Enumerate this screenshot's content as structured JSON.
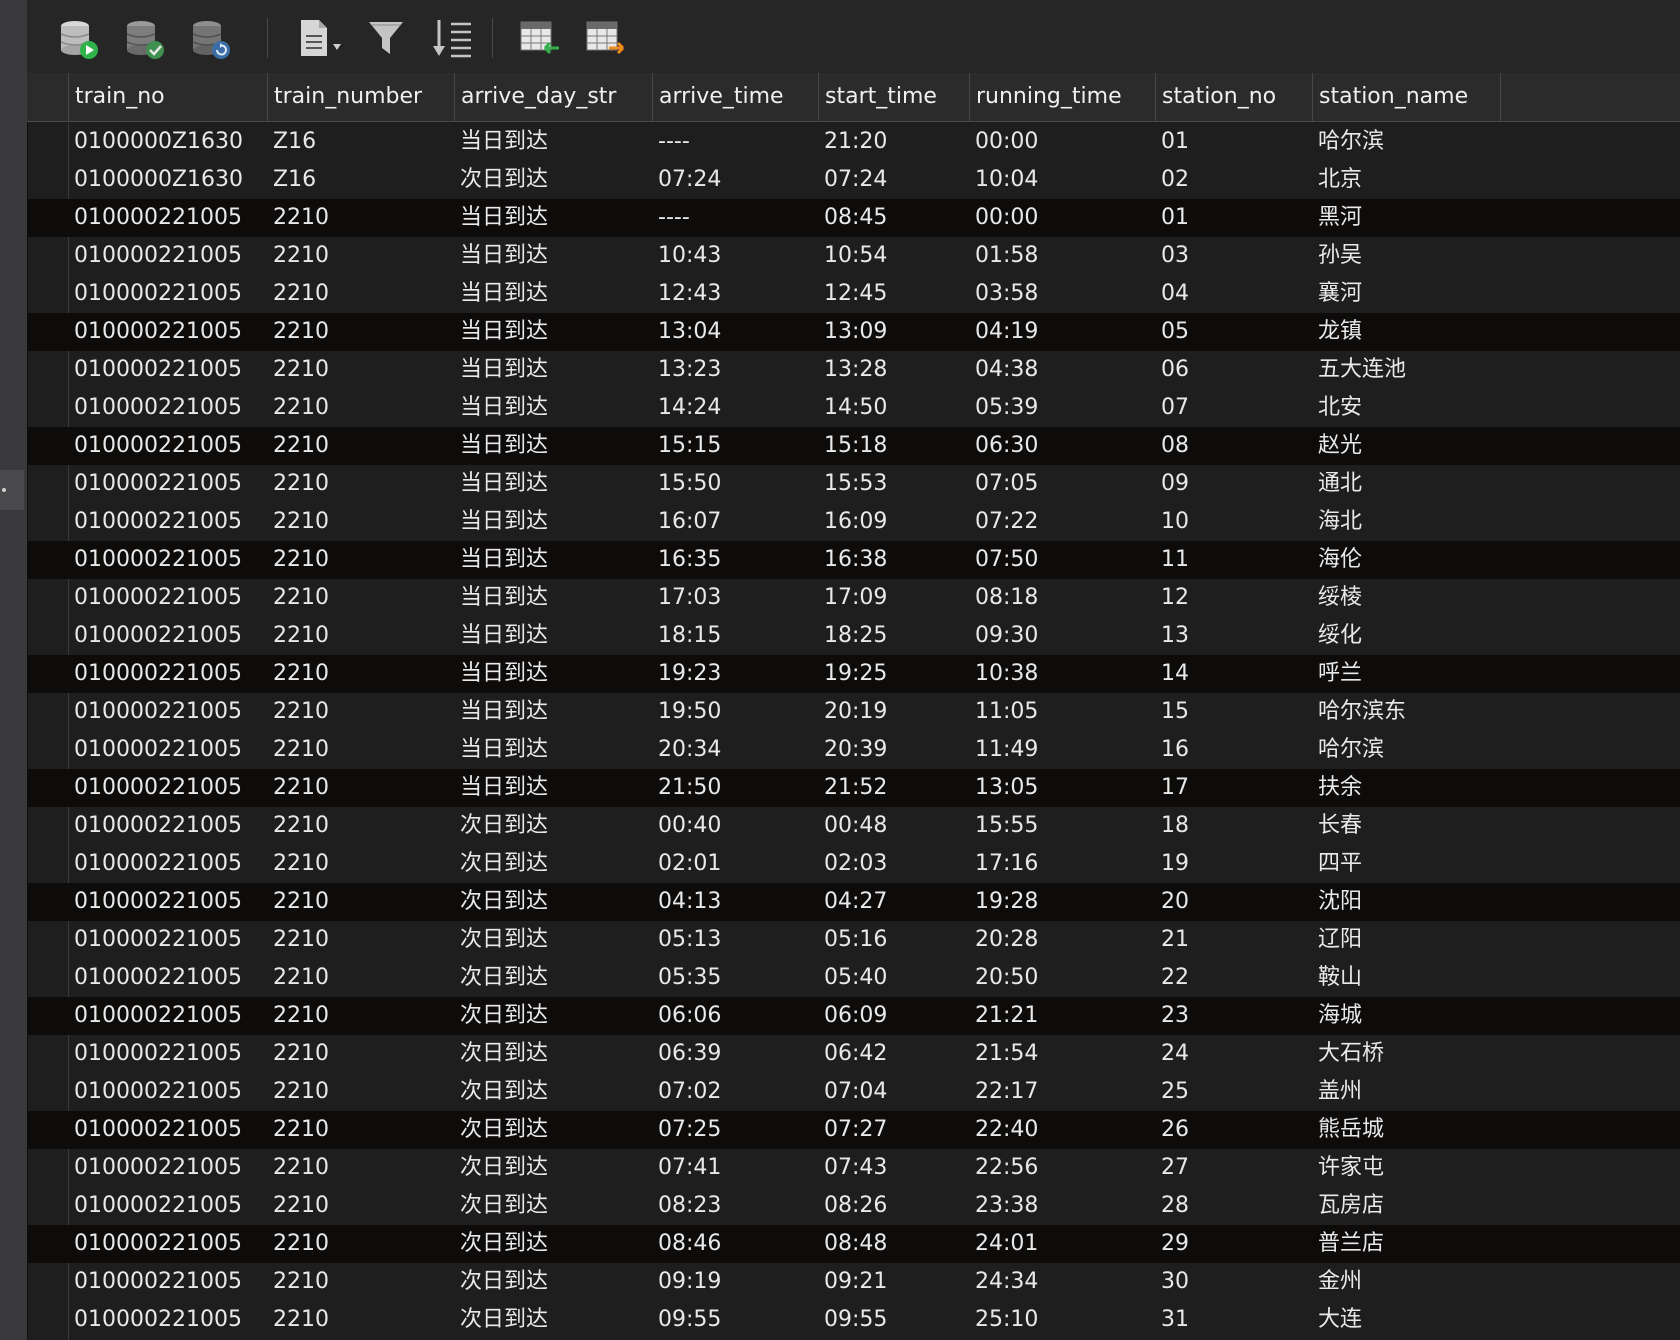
{
  "toolbar": {
    "icons": [
      "database-run-icon",
      "database-check-icon",
      "database-refresh-icon",
      "document-dropdown-icon",
      "filter-icon",
      "sort-icon",
      "table-import-icon",
      "table-export-icon"
    ]
  },
  "columns": [
    "train_no",
    "train_number",
    "arrive_day_str",
    "arrive_time",
    "start_time",
    "running_time",
    "station_no",
    "station_name"
  ],
  "rows": [
    [
      "0100000Z1630",
      "Z16",
      "当日到达",
      "----",
      "21:20",
      "00:00",
      "01",
      "哈尔滨"
    ],
    [
      "0100000Z1630",
      "Z16",
      "次日到达",
      "07:24",
      "07:24",
      "10:04",
      "02",
      "北京"
    ],
    [
      "010000221005",
      "2210",
      "当日到达",
      "----",
      "08:45",
      "00:00",
      "01",
      "黑河"
    ],
    [
      "010000221005",
      "2210",
      "当日到达",
      "10:43",
      "10:54",
      "01:58",
      "03",
      "孙吴"
    ],
    [
      "010000221005",
      "2210",
      "当日到达",
      "12:43",
      "12:45",
      "03:58",
      "04",
      "襄河"
    ],
    [
      "010000221005",
      "2210",
      "当日到达",
      "13:04",
      "13:09",
      "04:19",
      "05",
      "龙镇"
    ],
    [
      "010000221005",
      "2210",
      "当日到达",
      "13:23",
      "13:28",
      "04:38",
      "06",
      "五大连池"
    ],
    [
      "010000221005",
      "2210",
      "当日到达",
      "14:24",
      "14:50",
      "05:39",
      "07",
      "北安"
    ],
    [
      "010000221005",
      "2210",
      "当日到达",
      "15:15",
      "15:18",
      "06:30",
      "08",
      "赵光"
    ],
    [
      "010000221005",
      "2210",
      "当日到达",
      "15:50",
      "15:53",
      "07:05",
      "09",
      "通北"
    ],
    [
      "010000221005",
      "2210",
      "当日到达",
      "16:07",
      "16:09",
      "07:22",
      "10",
      "海北"
    ],
    [
      "010000221005",
      "2210",
      "当日到达",
      "16:35",
      "16:38",
      "07:50",
      "11",
      "海伦"
    ],
    [
      "010000221005",
      "2210",
      "当日到达",
      "17:03",
      "17:09",
      "08:18",
      "12",
      "绥棱"
    ],
    [
      "010000221005",
      "2210",
      "当日到达",
      "18:15",
      "18:25",
      "09:30",
      "13",
      "绥化"
    ],
    [
      "010000221005",
      "2210",
      "当日到达",
      "19:23",
      "19:25",
      "10:38",
      "14",
      "呼兰"
    ],
    [
      "010000221005",
      "2210",
      "当日到达",
      "19:50",
      "20:19",
      "11:05",
      "15",
      "哈尔滨东"
    ],
    [
      "010000221005",
      "2210",
      "当日到达",
      "20:34",
      "20:39",
      "11:49",
      "16",
      "哈尔滨"
    ],
    [
      "010000221005",
      "2210",
      "当日到达",
      "21:50",
      "21:52",
      "13:05",
      "17",
      "扶余"
    ],
    [
      "010000221005",
      "2210",
      "次日到达",
      "00:40",
      "00:48",
      "15:55",
      "18",
      "长春"
    ],
    [
      "010000221005",
      "2210",
      "次日到达",
      "02:01",
      "02:03",
      "17:16",
      "19",
      "四平"
    ],
    [
      "010000221005",
      "2210",
      "次日到达",
      "04:13",
      "04:27",
      "19:28",
      "20",
      "沈阳"
    ],
    [
      "010000221005",
      "2210",
      "次日到达",
      "05:13",
      "05:16",
      "20:28",
      "21",
      "辽阳"
    ],
    [
      "010000221005",
      "2210",
      "次日到达",
      "05:35",
      "05:40",
      "20:50",
      "22",
      "鞍山"
    ],
    [
      "010000221005",
      "2210",
      "次日到达",
      "06:06",
      "06:09",
      "21:21",
      "23",
      "海城"
    ],
    [
      "010000221005",
      "2210",
      "次日到达",
      "06:39",
      "06:42",
      "21:54",
      "24",
      "大石桥"
    ],
    [
      "010000221005",
      "2210",
      "次日到达",
      "07:02",
      "07:04",
      "22:17",
      "25",
      "盖州"
    ],
    [
      "010000221005",
      "2210",
      "次日到达",
      "07:25",
      "07:27",
      "22:40",
      "26",
      "熊岳城"
    ],
    [
      "010000221005",
      "2210",
      "次日到达",
      "07:41",
      "07:43",
      "22:56",
      "27",
      "许家屯"
    ],
    [
      "010000221005",
      "2210",
      "次日到达",
      "08:23",
      "08:26",
      "23:38",
      "28",
      "瓦房店"
    ],
    [
      "010000221005",
      "2210",
      "次日到达",
      "08:46",
      "08:48",
      "24:01",
      "29",
      "普兰店"
    ],
    [
      "010000221005",
      "2210",
      "次日到达",
      "09:19",
      "09:21",
      "24:34",
      "30",
      "金州"
    ],
    [
      "010000221005",
      "2210",
      "次日到达",
      "09:55",
      "09:55",
      "25:10",
      "31",
      "大连"
    ]
  ],
  "colors": {
    "background": "#1e1e1e",
    "row_dark": "#0e0c0b",
    "header": "#2b2b2b",
    "text": "#e9e9e9"
  }
}
